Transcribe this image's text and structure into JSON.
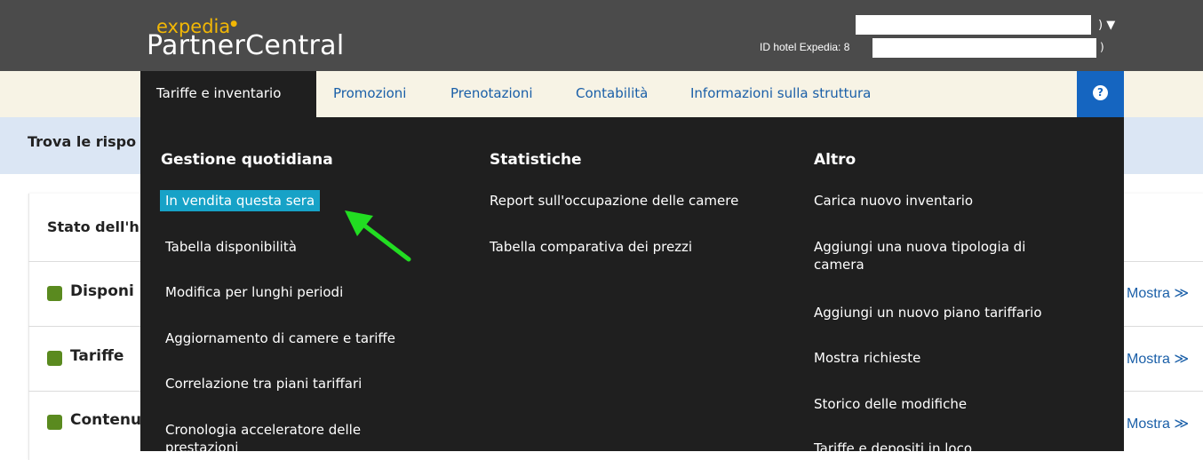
{
  "header": {
    "logo_small": "expedia",
    "logo_big": "PartnerCentral",
    "hotel_id_label": "ID hotel Expedia: 8",
    "hotel_paren": ")",
    "account_paren": ")",
    "account_caret": "▼"
  },
  "nav": {
    "tabs": [
      {
        "label": "Tariffe e inventario"
      },
      {
        "label": "Promozioni"
      },
      {
        "label": "Prenotazioni"
      },
      {
        "label": "Contabilità"
      },
      {
        "label": "Informazioni sulla struttura"
      }
    ],
    "help": "?"
  },
  "infobar": {
    "text": "Trova le rispo"
  },
  "card": {
    "title": "Stato dell'h",
    "rows": [
      {
        "label": "Disponi",
        "action": "Mostra ≫"
      },
      {
        "label": "Tariffe",
        "action": "Mostra ≫"
      },
      {
        "label": "Contenu",
        "action": "Mostra ≫"
      }
    ],
    "status_color": "#5a8a1f"
  },
  "dropdown": {
    "col1": {
      "heading": "Gestione quotidiana",
      "items": [
        "In vendita questa sera",
        "Tabella disponibilità",
        "Modifica per lunghi periodi",
        "Aggiornamento di camere e tariffe",
        "Correlazione tra piani tariffari",
        "Cronologia acceleratore delle prestazioni"
      ]
    },
    "col2": {
      "heading": "Statistiche",
      "items": [
        "Report sull'occupazione delle camere",
        "Tabella comparativa dei prezzi"
      ]
    },
    "col3": {
      "heading": "Altro",
      "items": [
        "Carica nuovo inventario",
        "Aggiungi una nuova tipologia di camera",
        "Aggiungi un nuovo piano tariffario",
        "Mostra richieste",
        "Storico delle modifiche",
        "Tariffe e depositi in loco"
      ]
    },
    "highlight_color": "#17a2c7",
    "arrow_color": "#22dd22"
  }
}
